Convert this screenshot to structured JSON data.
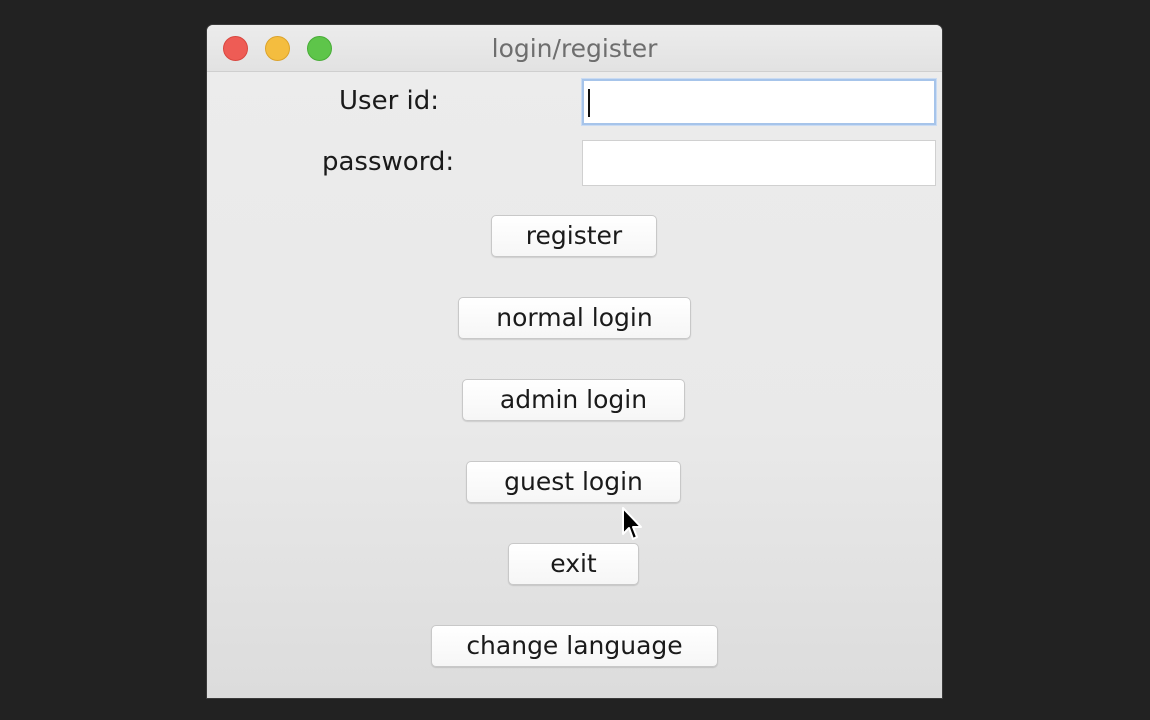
{
  "window": {
    "title": "login/register",
    "controls": {
      "close": "close-icon",
      "minimize": "minimize-icon",
      "zoom": "zoom-icon"
    },
    "colors": {
      "close": "#ee5c55",
      "minimize": "#f4bd3f",
      "zoom": "#5ec54a"
    }
  },
  "form": {
    "user_id_label": "User id:",
    "user_id_value": "",
    "password_label": "password:",
    "password_value": ""
  },
  "buttons": {
    "register": "register",
    "normal_login": "normal login",
    "admin_login": "admin login",
    "guest_login": "guest login",
    "exit": "exit",
    "change_language": "change language"
  },
  "cursor": {
    "icon": "mouse-pointer-icon"
  }
}
